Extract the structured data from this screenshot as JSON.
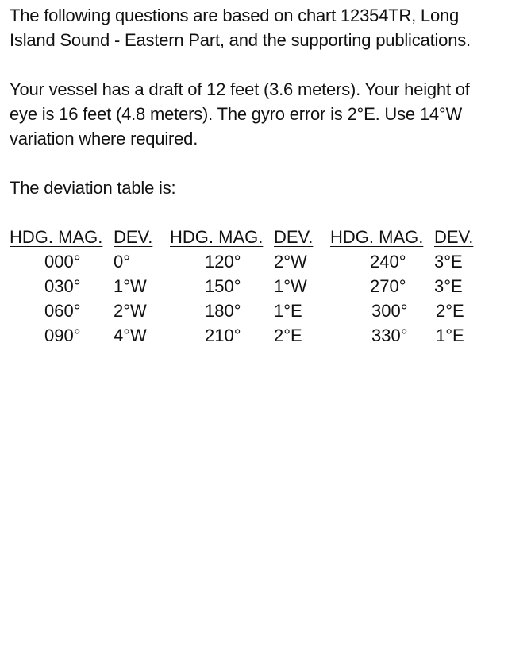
{
  "intro": "The following questions are based on chart 12354TR, Long Island Sound - Eastern Part, and the supporting publications.",
  "vessel_info": "Your vessel has a draft of 12 feet (3.6 meters). Your height of eye is 16 feet (4.8 meters). The gyro error is 2°E. Use 14°W variation where required.",
  "table_caption": "The deviation table is:",
  "deviation_table": {
    "headers": [
      "HDG. MAG.",
      "DEV.",
      "HDG. MAG.",
      "DEV.",
      "HDG. MAG.",
      "DEV."
    ],
    "rows": [
      [
        "000°",
        "0°",
        "120°",
        "2°W",
        "240°",
        "3°E"
      ],
      [
        "030°",
        "1°W",
        "150°",
        "1°W",
        "270°",
        "3°E"
      ],
      [
        "060°",
        "2°W",
        "180°",
        "1°E",
        "300°",
        "2°E"
      ],
      [
        "090°",
        "4°W",
        "210°",
        "2°E",
        "330°",
        "1°E"
      ]
    ]
  }
}
